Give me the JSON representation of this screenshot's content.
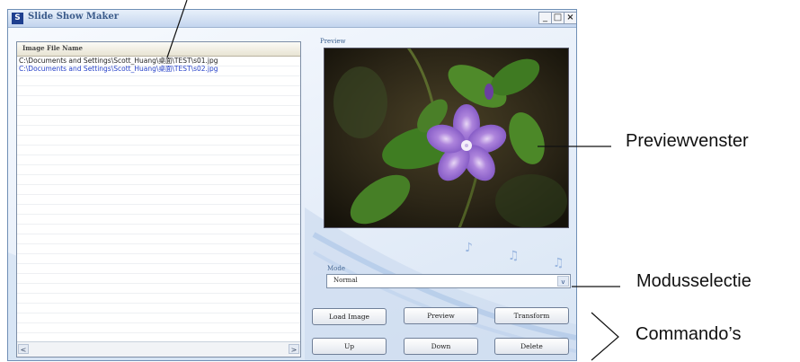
{
  "window": {
    "title": "Slide Show Maker",
    "app_icon": "app-icon",
    "controls": {
      "minimize": "_",
      "maximize": "□",
      "close": "×"
    }
  },
  "file_list": {
    "column_header": "Image File Name",
    "rows": [
      "C:\\Documents and Settings\\Scott_Huang\\桌面\\TEST\\s01.jpg",
      "C:\\Documents and Settings\\Scott_Huang\\桌面\\TEST\\s02.jpg"
    ],
    "scroll_left": "<",
    "scroll_right": ">"
  },
  "preview": {
    "label": "Preview",
    "image_subject": "purple periwinkle flower with green leaves"
  },
  "mode": {
    "label": "Mode",
    "selected": "Normal",
    "arrow": "v"
  },
  "buttons": {
    "load_image": "Load Image",
    "preview": "Preview",
    "transform": "Transform",
    "up": "Up",
    "down": "Down",
    "delete": "Delete"
  },
  "annotations": {
    "preview_window": "Previewvenster",
    "mode_selection": "Modusselectie",
    "commands": "Commando’s"
  },
  "colors": {
    "title_text": "#3a5a8a",
    "background": "#e6eef9",
    "selected_row_text": "#2540c8",
    "flower": "#9a6ad3"
  }
}
